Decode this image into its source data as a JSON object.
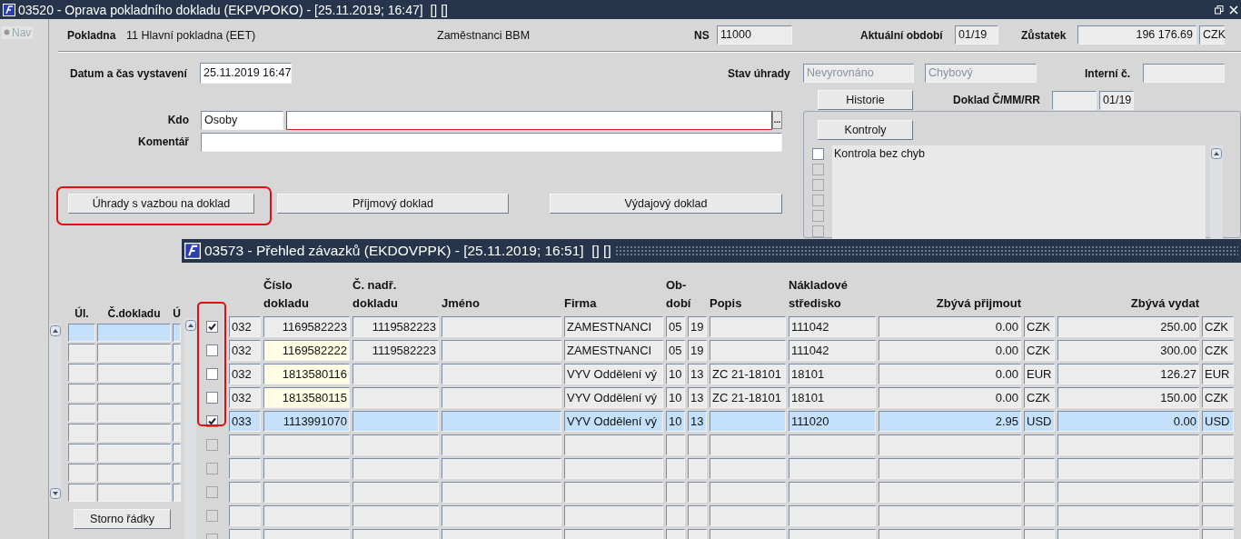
{
  "window": {
    "title": "03520 - Oprava pokladního dokladu (EKPVPOKO) - [25.11.2019; 16:47]  [] []"
  },
  "nav": {
    "label": "Nav"
  },
  "header": {
    "cash_desk_label": "Pokladna",
    "cash_desk": "11 Hlavní pokladna (EET)",
    "group": "Zaměstnanci BBM",
    "ns_label": "NS",
    "ns": "11000",
    "period_label": "Aktuální období",
    "period": "01/19",
    "balance_label": "Zůstatek",
    "balance": "196 176.69",
    "balance_currency": "CZK"
  },
  "form": {
    "issued_label": "Datum a čas vystavení",
    "issued": "25.11.2019 16:47",
    "payment_state_label": "Stav úhrady",
    "payment_state": "Nevyrovnáno",
    "check_state": "Chybový",
    "internal_label": "Interní č.",
    "history_button": "Historie",
    "doc_label": "Doklad Č/MM/RR",
    "doc_period": "01/19",
    "who_label": "Kdo",
    "who_type": "Osoby",
    "who_required": true,
    "lov_button": "...",
    "comment_label": "Komentář"
  },
  "buttons": [
    {
      "label": "Úhrady s vazbou na doklad",
      "highlighted": true
    },
    {
      "label": "Příjmový doklad",
      "highlighted": false
    },
    {
      "label": "Výdajový doklad",
      "highlighted": false
    }
  ],
  "checks": {
    "button": "Kontroly",
    "items": [
      {
        "kind": "check",
        "label": "Kontrola bez chyb",
        "checked": false
      },
      {
        "kind": "empty",
        "checked": false
      },
      {
        "kind": "empty",
        "checked": false
      },
      {
        "kind": "empty",
        "checked": false
      },
      {
        "kind": "empty",
        "checked": false
      },
      {
        "kind": "empty",
        "checked": false
      }
    ]
  },
  "payments": {
    "columns": [
      "Úl.",
      "Č.dokladu",
      "Ú"
    ],
    "rows": [
      {
        "selected": true
      },
      {
        "selected": false
      },
      {
        "selected": false
      },
      {
        "selected": false
      },
      {
        "selected": false
      },
      {
        "selected": false
      },
      {
        "selected": false
      },
      {
        "selected": false
      },
      {
        "selected": false
      }
    ],
    "storno_button": "Storno řádky"
  },
  "overview_window": {
    "title": "03573 - Přehled závazků (EKDOVPPK) - [25.11.2019; 16:51]  [] []",
    "checkbox_column_highlighted": true,
    "columns": [
      {
        "kind": "code"
      },
      {
        "kind": "number",
        "header": "Číslo\ndokladu"
      },
      {
        "kind": "number",
        "header": "Č. nadř.\ndokladu"
      },
      {
        "kind": "text",
        "header": "Jméno"
      },
      {
        "kind": "text",
        "header": "Firma"
      },
      {
        "kind": "period",
        "header": "Ob-\ndobí"
      },
      {
        "kind": "period"
      },
      {
        "kind": "text",
        "header": "Popis"
      },
      {
        "kind": "text",
        "header": "Nákladové\nstředisko"
      },
      {
        "kind": "amount",
        "header": "Zbývá přijmout"
      },
      {
        "kind": "currency"
      },
      {
        "kind": "amount",
        "header": "Zbývá vydat"
      },
      {
        "kind": "currency"
      }
    ],
    "rows": [
      {
        "kind": "record",
        "checked": true,
        "selected": false,
        "number_highlighted": false,
        "cells": [
          "032",
          "1169582223",
          "1119582223",
          null,
          "ZAMESTNANCI",
          "05",
          "19",
          null,
          "111042",
          "0.00",
          "CZK",
          "250.00",
          "CZK"
        ]
      },
      {
        "kind": "record",
        "checked": false,
        "selected": false,
        "number_highlighted": true,
        "cells": [
          "032",
          "1169582222",
          "1119582223",
          null,
          "ZAMESTNANCI",
          "05",
          "19",
          null,
          "111042",
          "0.00",
          "CZK",
          "300.00",
          "CZK"
        ]
      },
      {
        "kind": "record",
        "checked": false,
        "selected": false,
        "number_highlighted": true,
        "cells": [
          "032",
          "1813580116",
          null,
          null,
          "VYV Oddělení vý",
          "10",
          "13",
          "ZC 21-18101",
          "18101",
          "0.00",
          "EUR",
          "126.27",
          "EUR"
        ]
      },
      {
        "kind": "record",
        "checked": false,
        "selected": false,
        "number_highlighted": true,
        "cells": [
          "032",
          "1813580115",
          null,
          null,
          "VYV Oddělení vý",
          "10",
          "13",
          "ZC 21-18101",
          "18101",
          "0.00",
          "CZK",
          "150.00",
          "CZK"
        ]
      },
      {
        "kind": "record",
        "checked": true,
        "selected": true,
        "number_highlighted": false,
        "cells": [
          "033",
          "1113991070",
          null,
          null,
          "VYV Oddělení vý",
          "10",
          "13",
          null,
          "111020",
          "2.95",
          "USD",
          "0.00",
          "USD"
        ]
      },
      {
        "kind": "empty",
        "checked": false,
        "selected": false
      },
      {
        "kind": "empty",
        "checked": false,
        "selected": false
      },
      {
        "kind": "empty",
        "checked": false,
        "selected": false
      },
      {
        "kind": "empty",
        "checked": false,
        "selected": false
      },
      {
        "kind": "empty",
        "checked": false,
        "selected": false
      }
    ]
  }
}
